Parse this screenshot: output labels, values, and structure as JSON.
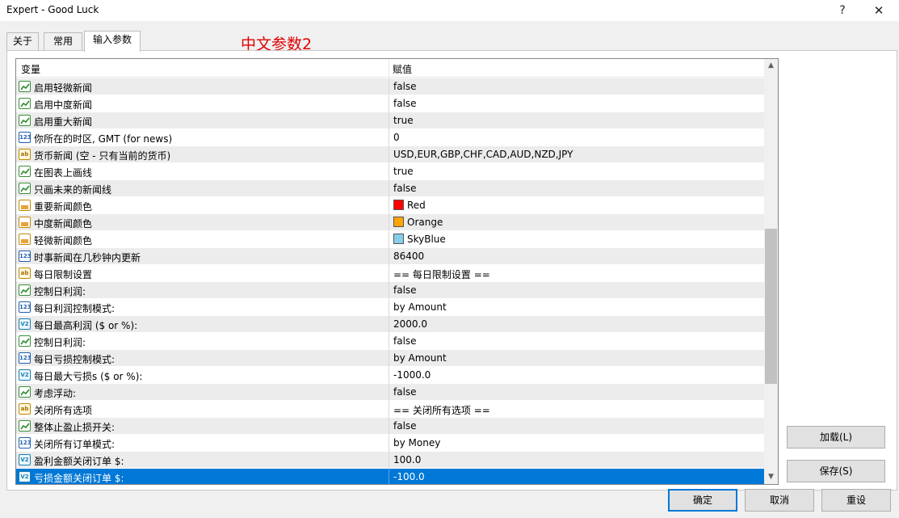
{
  "window": {
    "title": "Expert - Good Luck",
    "help": "?",
    "close": "✕"
  },
  "tabs": [
    {
      "label": "关于"
    },
    {
      "label": "常用"
    },
    {
      "label": "输入参数"
    }
  ],
  "caption": "中文参数2",
  "grid": {
    "header_variable": "变量",
    "header_value": "赋值",
    "rows": [
      {
        "type": "bool",
        "variable": "启用轻微新闻",
        "value": "false"
      },
      {
        "type": "bool",
        "variable": "启用中度新闻",
        "value": "false"
      },
      {
        "type": "bool",
        "variable": "启用重大新闻",
        "value": "true"
      },
      {
        "type": "num",
        "variable": "你所在的时区, GMT (for news)",
        "value": "0"
      },
      {
        "type": "str",
        "variable": "货币新闻 (空 - 只有当前的货币)",
        "value": "USD,EUR,GBP,CHF,CAD,AUD,NZD,JPY"
      },
      {
        "type": "bool",
        "variable": "在图表上画线",
        "value": "true"
      },
      {
        "type": "bool",
        "variable": "只画未来的新闻线",
        "value": "false"
      },
      {
        "type": "color",
        "variable": "重要新闻颜色",
        "value": "Red",
        "swatch": "#ff0000"
      },
      {
        "type": "color",
        "variable": "中度新闻颜色",
        "value": "Orange",
        "swatch": "#ffa500"
      },
      {
        "type": "color",
        "variable": "轻微新闻颜色",
        "value": "SkyBlue",
        "swatch": "#87ceeb"
      },
      {
        "type": "num",
        "variable": "时事新闻在几秒钟内更新",
        "value": "86400"
      },
      {
        "type": "str",
        "variable": "每日限制设置",
        "value": "== 每日限制设置 =="
      },
      {
        "type": "bool",
        "variable": "控制日利润:",
        "value": "false"
      },
      {
        "type": "num",
        "variable": "每日利润控制模式:",
        "value": "by Amount"
      },
      {
        "type": "dbl",
        "variable": "每日最高利润 ($ or %):",
        "value": "2000.0"
      },
      {
        "type": "bool",
        "variable": "控制日利润:",
        "value": "false"
      },
      {
        "type": "num",
        "variable": "每日亏损控制模式:",
        "value": "by Amount"
      },
      {
        "type": "dbl",
        "variable": "每日最大亏损s ($ or %):",
        "value": "-1000.0"
      },
      {
        "type": "bool",
        "variable": "考虑浮动:",
        "value": "false"
      },
      {
        "type": "str",
        "variable": "关闭所有选项",
        "value": "== 关闭所有选项 =="
      },
      {
        "type": "bool",
        "variable": "整体止盈止损开关:",
        "value": "false"
      },
      {
        "type": "num",
        "variable": "关闭所有订单模式:",
        "value": "by Money"
      },
      {
        "type": "dbl",
        "variable": "盈利金额关闭订单 $:",
        "value": "100.0"
      },
      {
        "type": "dbl",
        "variable": "亏损金额关闭订单 $:",
        "value": "-100.0",
        "selected": true
      }
    ]
  },
  "buttons": {
    "load": "加载(L)",
    "save": "保存(S)",
    "ok": "确定",
    "cancel": "取消",
    "reset": "重设"
  },
  "icon_glyphs": {
    "num": "123",
    "str": "ab",
    "dbl": "V2"
  }
}
